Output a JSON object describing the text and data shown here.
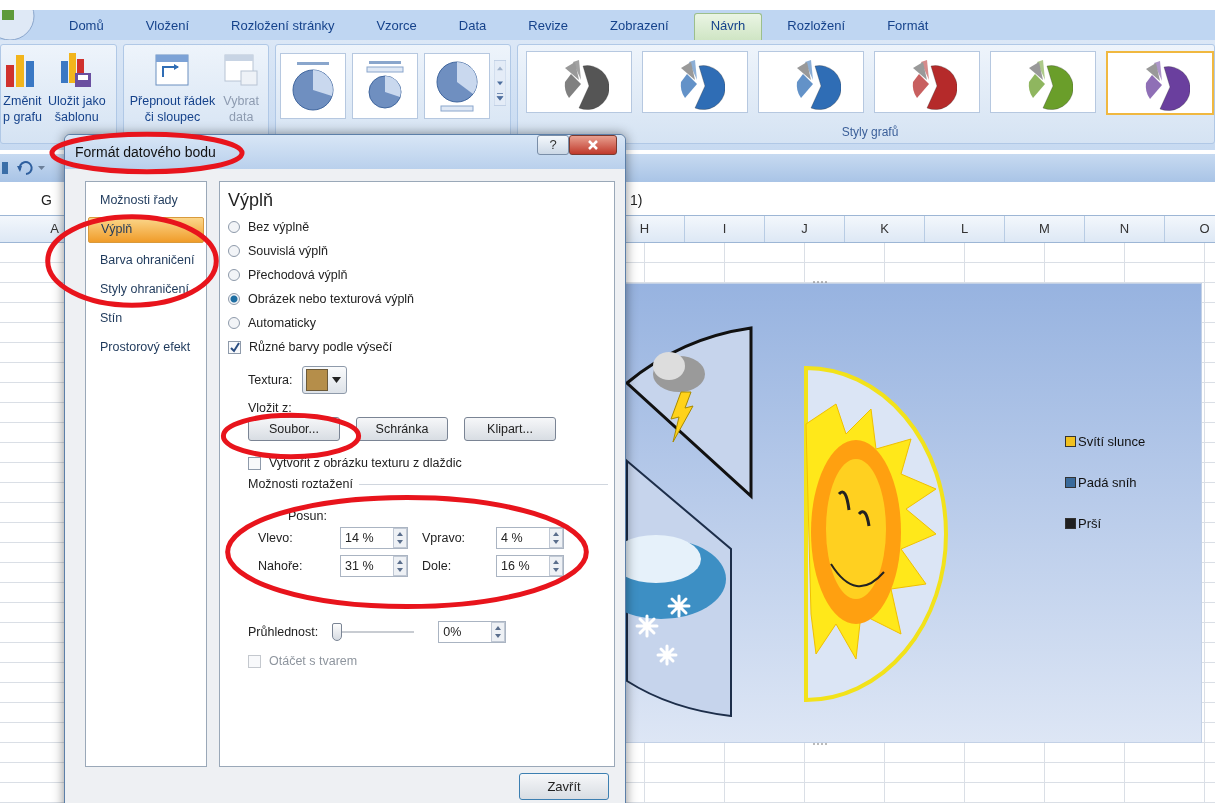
{
  "ribbon": {
    "tabs": [
      {
        "label": "Domů",
        "selected": false
      },
      {
        "label": "Vložení",
        "selected": false
      },
      {
        "label": "Rozložení stránky",
        "selected": false
      },
      {
        "label": "Vzorce",
        "selected": false
      },
      {
        "label": "Data",
        "selected": false
      },
      {
        "label": "Revize",
        "selected": false
      },
      {
        "label": "Zobrazení",
        "selected": false
      },
      {
        "label": "Návrh",
        "selected": true
      },
      {
        "label": "Rozložení",
        "selected": false
      },
      {
        "label": "Formát",
        "selected": false
      }
    ],
    "type_buttons": [
      {
        "kind": "change-type",
        "lines": [
          "Změnit",
          "p grafu"
        ],
        "disabled": false
      },
      {
        "kind": "save-template",
        "lines": [
          "Uložit jako",
          "šablonu"
        ],
        "disabled": false
      }
    ],
    "data_buttons": [
      {
        "kind": "switch",
        "lines": [
          "Přepnout řádek",
          "či sloupec"
        ],
        "disabled": false
      },
      {
        "kind": "select-data",
        "lines": [
          "Vybrat",
          "data"
        ],
        "disabled": true
      }
    ],
    "styles": [
      {
        "color": "#555555",
        "selected": false
      },
      {
        "color": "#2f6db5",
        "selected": false
      },
      {
        "color": "#2f6db5",
        "selected": false
      },
      {
        "color": "#b52a2a",
        "selected": false
      },
      {
        "color": "#6a9e2a",
        "selected": false
      },
      {
        "color": "#6a3f9e",
        "selected": true
      }
    ],
    "styles_label": "Styly grafů"
  },
  "sheet": {
    "name_box": "G",
    "formula": "1)",
    "columns": [
      "A",
      "H",
      "I",
      "J",
      "K",
      "L",
      "M",
      "N",
      "O"
    ]
  },
  "chart": {
    "legend": [
      {
        "label": "Svítí slunce",
        "color": "#f0c020"
      },
      {
        "label": "Padá sníh",
        "color": "#3a6a9a"
      },
      {
        "label": "Prší",
        "color": "#202020"
      }
    ]
  },
  "dialog": {
    "title": "Formát datového bodu",
    "help_label": "?",
    "nav": [
      {
        "label": "Možnosti řady",
        "selected": false
      },
      {
        "label": "Výplň",
        "selected": true
      },
      {
        "label": "Barva ohraničení",
        "selected": false
      },
      {
        "label": "Styly ohraničení",
        "selected": false
      },
      {
        "label": "Stín",
        "selected": false
      },
      {
        "label": "Prostorový efekt",
        "selected": false
      }
    ],
    "heading": "Výplň",
    "fill_options": [
      {
        "label": "Bez výplně",
        "kind": "radio",
        "selected": false
      },
      {
        "label": "Souvislá výplň",
        "kind": "radio",
        "selected": false
      },
      {
        "label": "Přechodová výplň",
        "kind": "radio",
        "selected": false
      },
      {
        "label": "Obrázek nebo texturová výplň",
        "kind": "radio",
        "selected": true
      },
      {
        "label": "Automaticky",
        "kind": "radio",
        "selected": false
      },
      {
        "label": "Různé barvy podle výsečí",
        "kind": "checkbox",
        "checked": true
      }
    ],
    "texture_label": "Textura:",
    "insert_label": "Vložit z:",
    "insert_buttons": [
      "Soubor...",
      "Schránka",
      "Klipart..."
    ],
    "tile_option": {
      "label": "Vytvořit z obrázku texturu z dlaždic",
      "checked": false
    },
    "stretch_label": "Možnosti roztažení",
    "offset_label": "Posun:",
    "offsets": [
      {
        "label": "Vlevo:",
        "value": "14 %"
      },
      {
        "label": "Vpravo:",
        "value": "4 %"
      },
      {
        "label": "Nahoře:",
        "value": "31 %"
      },
      {
        "label": "Dole:",
        "value": "16 %"
      }
    ],
    "transparency": {
      "label": "Průhlednost:",
      "level": 0,
      "value": "0%"
    },
    "rotate_option": {
      "label": "Otáčet s tvarem",
      "checked": false,
      "disabled": true
    },
    "close_button": "Zavřít"
  }
}
